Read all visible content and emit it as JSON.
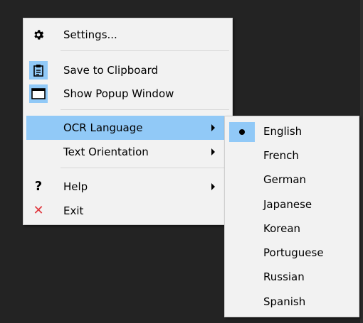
{
  "main_menu": {
    "items": [
      {
        "label": "Settings...",
        "icon": "gear-icon"
      },
      {
        "label": "Save to Clipboard",
        "icon": "clipboard-icon"
      },
      {
        "label": "Show Popup Window",
        "icon": "window-icon"
      },
      {
        "label": "OCR Language",
        "has_submenu": true,
        "highlighted": true
      },
      {
        "label": "Text Orientation",
        "has_submenu": true
      },
      {
        "label": "Help",
        "icon": "question-icon",
        "has_submenu": true
      },
      {
        "label": "Exit",
        "icon": "close-icon"
      }
    ]
  },
  "icons": {
    "question": "?",
    "exit": "✕"
  },
  "language_menu": {
    "selected": "English",
    "items": [
      "English",
      "French",
      "German",
      "Japanese",
      "Korean",
      "Portuguese",
      "Russian",
      "Spanish"
    ]
  },
  "colors": {
    "highlight": "#91c9f7",
    "menu_bg": "#f2f2f2",
    "desktop_bg": "#232323",
    "exit_icon": "#e0383e"
  }
}
